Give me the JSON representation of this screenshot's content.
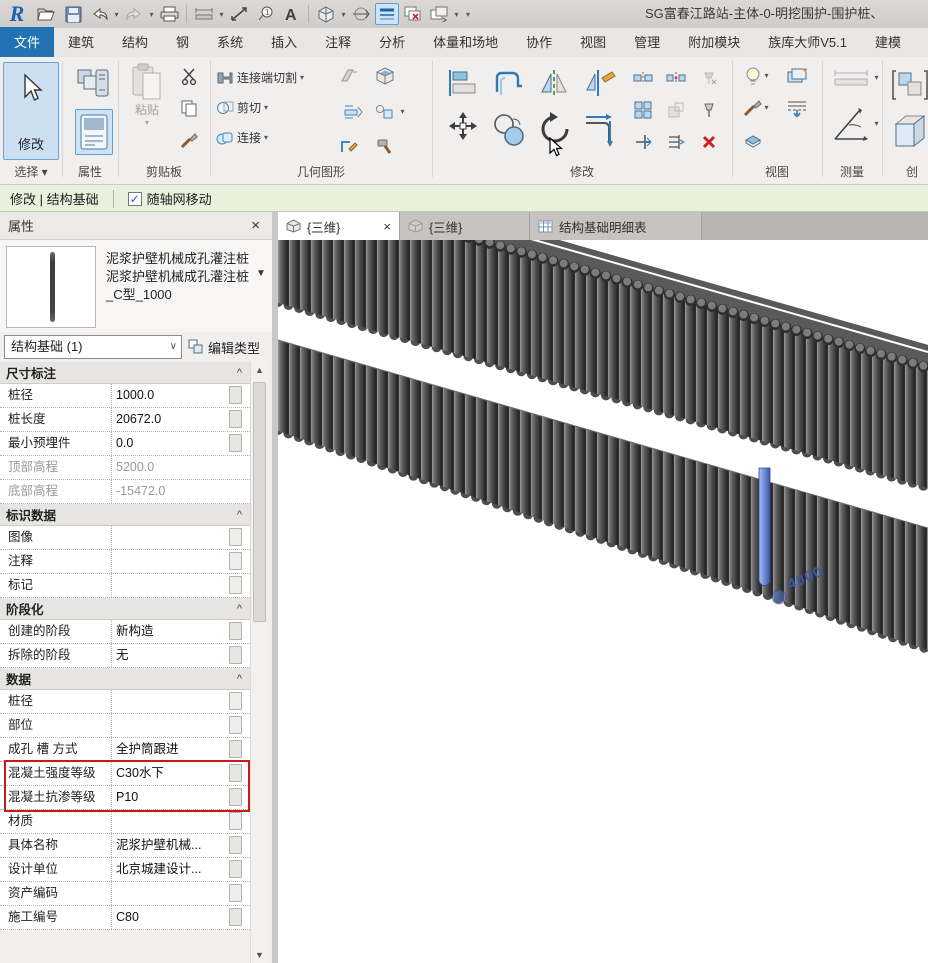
{
  "window": {
    "title": "SG富春江路站-主体-0-明挖围护-围护桩、"
  },
  "qat_icons": [
    "revit-logo",
    "open-file-icon",
    "save-icon",
    "undo-icon",
    "redo-icon",
    "print-icon",
    "measure-icon",
    "aligned-dimension-icon",
    "tag-icon",
    "text-icon",
    "default-3d-view-icon",
    "section-icon",
    "thin-lines-icon",
    "close-inactive-windows-icon",
    "switch-windows-icon",
    "customize-icon"
  ],
  "ribbon": {
    "tabs": [
      "文件",
      "建筑",
      "结构",
      "钢",
      "系统",
      "插入",
      "注释",
      "分析",
      "体量和场地",
      "协作",
      "视图",
      "管理",
      "附加模块",
      "族库大师V5.1",
      "建模"
    ],
    "active_tab": "文件",
    "modify_button": "修改",
    "paste_button": "粘贴",
    "geometry_buttons": {
      "join_cut": "连接端切割",
      "cut": "剪切",
      "join": "连接"
    },
    "panel_labels": {
      "select": "选择",
      "properties": "属性",
      "clipboard": "剪贴板",
      "geometry": "几何图形",
      "modify": "修改",
      "view": "视图",
      "measure": "测量",
      "create": "创"
    }
  },
  "options_bar": {
    "context_label": "修改 | 结构基础",
    "checkbox_label": "随轴网移动",
    "checkbox_checked": true,
    "check_glyph": "✓"
  },
  "properties": {
    "header": "属性",
    "close_glyph": "×",
    "type_name_line1": "泥浆护壁机械成孔灌注桩",
    "type_name_line2": "泥浆护壁机械成孔灌注桩",
    "type_name_line3": "_C型_1000",
    "filter_value": "结构基础 (1)",
    "edit_type_label": "编辑类型",
    "sections": [
      {
        "title": "尺寸标注",
        "rows": [
          {
            "label": "桩径",
            "value": "1000.0"
          },
          {
            "label": "桩长度",
            "value": "20672.0"
          },
          {
            "label": "最小预埋件",
            "value": "0.0"
          },
          {
            "label": "顶部高程",
            "value": "5200.0",
            "grayed": true
          },
          {
            "label": "底部高程",
            "value": "-15472.0",
            "grayed": true
          }
        ]
      },
      {
        "title": "标识数据",
        "rows": [
          {
            "label": "图像",
            "value": ""
          },
          {
            "label": "注释",
            "value": ""
          },
          {
            "label": "标记",
            "value": ""
          }
        ]
      },
      {
        "title": "阶段化",
        "rows": [
          {
            "label": "创建的阶段",
            "value": "新构造"
          },
          {
            "label": "拆除的阶段",
            "value": "无"
          }
        ]
      },
      {
        "title": "数据",
        "rows": [
          {
            "label": "桩径",
            "value": ""
          },
          {
            "label": "部位",
            "value": ""
          },
          {
            "label": "成孔 槽 方式",
            "value": "全护筒跟进"
          },
          {
            "label": "混凝土强度等级",
            "value": "C30水下",
            "highlighted": true
          },
          {
            "label": "混凝土抗渗等级",
            "value": "P10",
            "highlighted": true
          },
          {
            "label": "材质",
            "value": ""
          },
          {
            "label": "具体名称",
            "value": "泥浆护壁机械..."
          },
          {
            "label": "设计单位",
            "value": "北京城建设计..."
          },
          {
            "label": "资产编码",
            "value": ""
          },
          {
            "label": "施工编号",
            "value": "C80"
          }
        ]
      }
    ]
  },
  "view_tabs": [
    {
      "label": "{三维}",
      "active": true,
      "icon": "3d-house-icon"
    },
    {
      "label": "{三维}",
      "active": false,
      "icon": "3d-house-icon"
    },
    {
      "label": "结构基础明细表",
      "active": false,
      "icon": "schedule-icon"
    }
  ],
  "viewport": {
    "selected_element": "围护桩 (selected pile)",
    "dimension_label": "4000"
  },
  "colors": {
    "accent_blue": "#2273b4",
    "selection_blue": "#5d7fc7",
    "highlight_red": "#cf1717",
    "options_bar_green": "#e9f0dc",
    "pile_gray": "#4f4f4f"
  }
}
